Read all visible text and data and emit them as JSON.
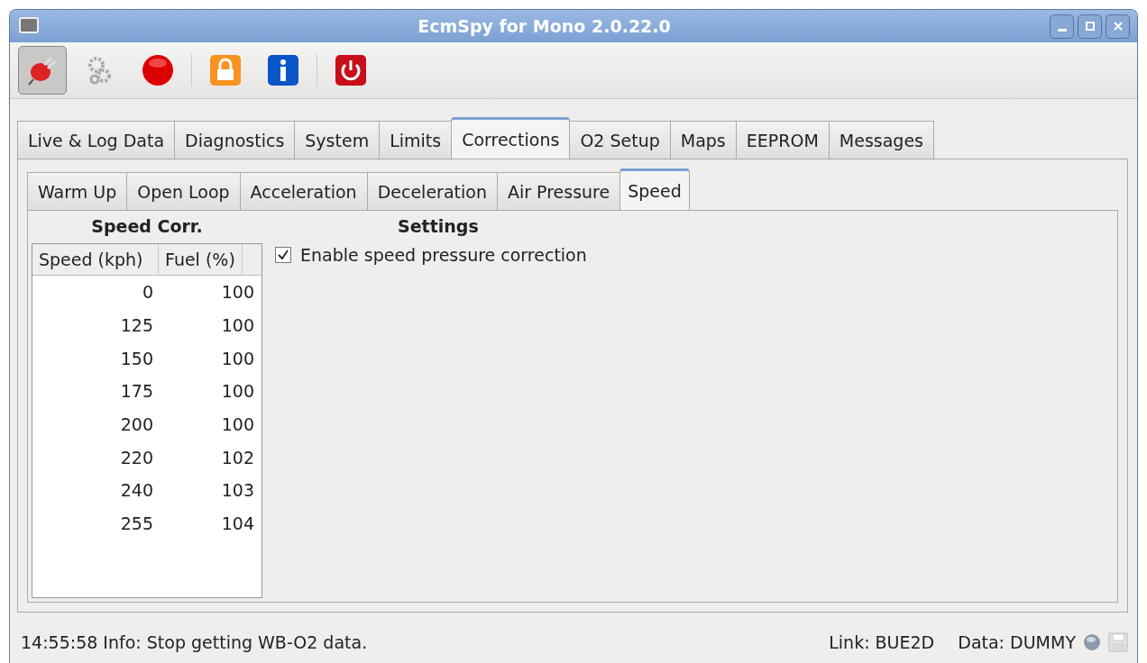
{
  "window": {
    "title": "EcmSpy for Mono 2.0.22.0"
  },
  "toolbar": [
    {
      "kind": "plug",
      "pressed": true
    },
    {
      "kind": "gears",
      "pressed": false
    },
    {
      "kind": "record",
      "pressed": false
    },
    {
      "kind": "separator"
    },
    {
      "kind": "lock",
      "pressed": false
    },
    {
      "kind": "info",
      "pressed": false
    },
    {
      "kind": "separator"
    },
    {
      "kind": "power",
      "pressed": false
    }
  ],
  "tabs": [
    {
      "label": "Live & Log Data",
      "selected": false
    },
    {
      "label": "Diagnostics",
      "selected": false
    },
    {
      "label": "System",
      "selected": false
    },
    {
      "label": "Limits",
      "selected": false
    },
    {
      "label": "Corrections",
      "selected": true
    },
    {
      "label": "O2 Setup",
      "selected": false
    },
    {
      "label": "Maps",
      "selected": false
    },
    {
      "label": "EEPROM",
      "selected": false
    },
    {
      "label": "Messages",
      "selected": false
    }
  ],
  "subtabs": [
    {
      "label": "Warm Up",
      "selected": false
    },
    {
      "label": "Open Loop",
      "selected": false
    },
    {
      "label": "Acceleration",
      "selected": false
    },
    {
      "label": "Deceleration",
      "selected": false
    },
    {
      "label": "Air Pressure",
      "selected": false
    },
    {
      "label": "Speed",
      "selected": true
    }
  ],
  "table": {
    "title": "Speed Corr.",
    "columns": [
      "Speed (kph)",
      "Fuel (%)"
    ],
    "rows": [
      [
        "0",
        "100"
      ],
      [
        "125",
        "100"
      ],
      [
        "150",
        "100"
      ],
      [
        "175",
        "100"
      ],
      [
        "200",
        "100"
      ],
      [
        "220",
        "102"
      ],
      [
        "240",
        "103"
      ],
      [
        "255",
        "104"
      ]
    ]
  },
  "settings": {
    "title": "Settings",
    "checkbox": {
      "label": "Enable speed pressure correction",
      "checked": true
    }
  },
  "status_bar": {
    "message": "14:55:58 Info: Stop getting WB-O2 data.",
    "link": "Link: BUE2D",
    "data": "Data: DUMMY"
  }
}
